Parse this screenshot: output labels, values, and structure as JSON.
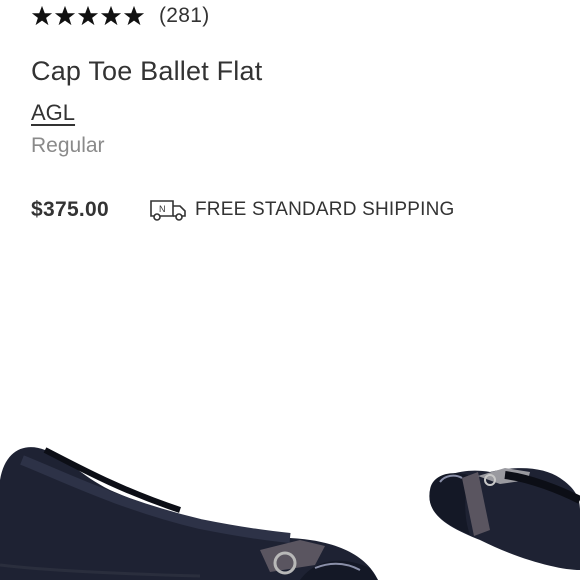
{
  "product": {
    "rating": 5,
    "review_count": "(281)",
    "title": "Cap Toe Ballet Flat",
    "brand": "AGL",
    "fit": "Regular",
    "price": "$375.00",
    "shipping": "FREE STANDARD SHIPPING"
  },
  "icons": {
    "star": "star-icon",
    "shipping": "truck-icon"
  },
  "colors": {
    "text": "#333333",
    "muted": "#8a8a8a",
    "shoe": "#1e2233",
    "strap": "#5a5560"
  }
}
